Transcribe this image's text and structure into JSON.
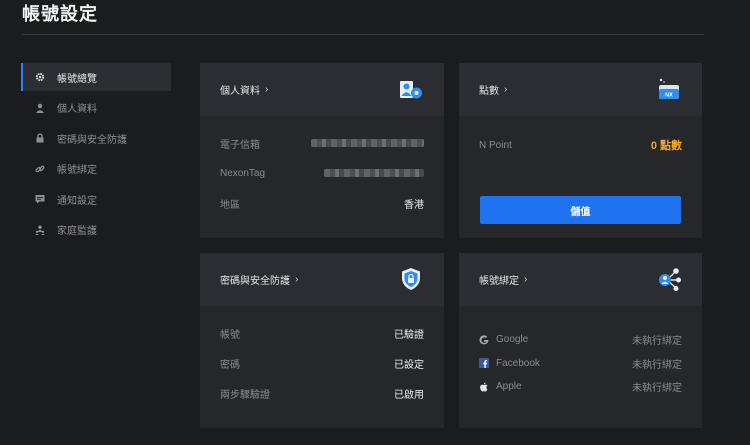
{
  "header": {
    "title": "帳號設定"
  },
  "sidebar": {
    "items": [
      {
        "label": "帳號總覽",
        "icon": "gear-icon",
        "active": true
      },
      {
        "label": "個人資料",
        "icon": "user-icon",
        "active": false
      },
      {
        "label": "密碼與安全防護",
        "icon": "lock-icon",
        "active": false
      },
      {
        "label": "帳號綁定",
        "icon": "link-icon",
        "active": false
      },
      {
        "label": "通知設定",
        "icon": "message-icon",
        "active": false
      },
      {
        "label": "家庭監護",
        "icon": "family-icon",
        "active": false
      }
    ]
  },
  "profile_card": {
    "title": "個人資料",
    "rows": [
      {
        "label": "電子信箱",
        "value": ""
      },
      {
        "label": "NexonTag",
        "value": ""
      },
      {
        "label": "地區",
        "value": "香港"
      }
    ]
  },
  "points_card": {
    "title": "點數",
    "label": "N Point",
    "value": "0 點數",
    "button": "儲值"
  },
  "security_card": {
    "title": "密碼與安全防護",
    "rows": [
      {
        "label": "帳號",
        "value": "已驗證"
      },
      {
        "label": "密碼",
        "value": "已設定"
      },
      {
        "label": "兩步驟驗證",
        "value": "已啟用"
      }
    ]
  },
  "binding_card": {
    "title": "帳號綁定",
    "rows": [
      {
        "label": "Google",
        "status": "未執行綁定",
        "icon": "google-icon"
      },
      {
        "label": "Facebook",
        "status": "未執行綁定",
        "icon": "facebook-icon"
      },
      {
        "label": "Apple",
        "status": "未執行綁定",
        "icon": "apple-icon"
      }
    ]
  },
  "colors": {
    "accent": "#1f73f0",
    "points": "#f5a623",
    "background": "#1b1c20",
    "card": "#26272b"
  }
}
